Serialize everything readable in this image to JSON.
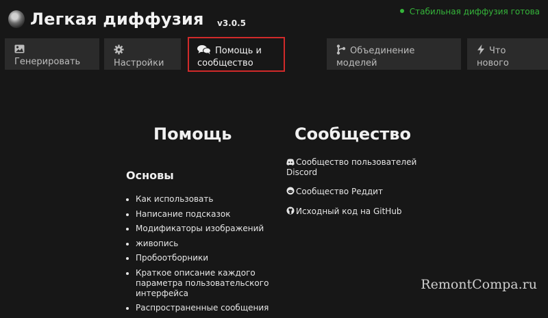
{
  "header": {
    "title": "Легкая диффузия",
    "version": "v3.0.5",
    "status": "Стабильная диффузия готова",
    "status_color": "#35b53a"
  },
  "tabs": [
    {
      "icon": "image-icon",
      "label": "Генерировать",
      "active": false
    },
    {
      "icon": "gear-icon",
      "label": "Настройки",
      "active": false
    },
    {
      "icon": "comments-icon",
      "label_line1": "Помощь и",
      "label_line2": "сообщество",
      "active": true
    },
    {
      "icon": "merge-icon",
      "label_line1": "Объединение",
      "label_line2": "моделей",
      "active": false
    },
    {
      "icon": "bolt-icon",
      "label_line1": "Что",
      "label_line2": "нового",
      "active": false
    }
  ],
  "highlight_color": "#d22a2a",
  "help": {
    "title": "Помощь",
    "basics_title": "Основы",
    "items": [
      "Как использовать",
      "Написание подсказок",
      "Модификаторы изображений",
      "живопись",
      "Пробоотборники",
      "Краткое описание каждого параметра пользовательского интерфейса",
      "Распространенные сообщения"
    ]
  },
  "community": {
    "title": "Сообщество",
    "items": [
      {
        "icon": "discord-icon",
        "label": "Сообщество пользователей Discord"
      },
      {
        "icon": "reddit-icon",
        "label": "Сообщество Реддит"
      },
      {
        "icon": "github-icon",
        "label": "Исходный код на GitHub"
      }
    ]
  },
  "watermark": "RemontCompa.ru"
}
